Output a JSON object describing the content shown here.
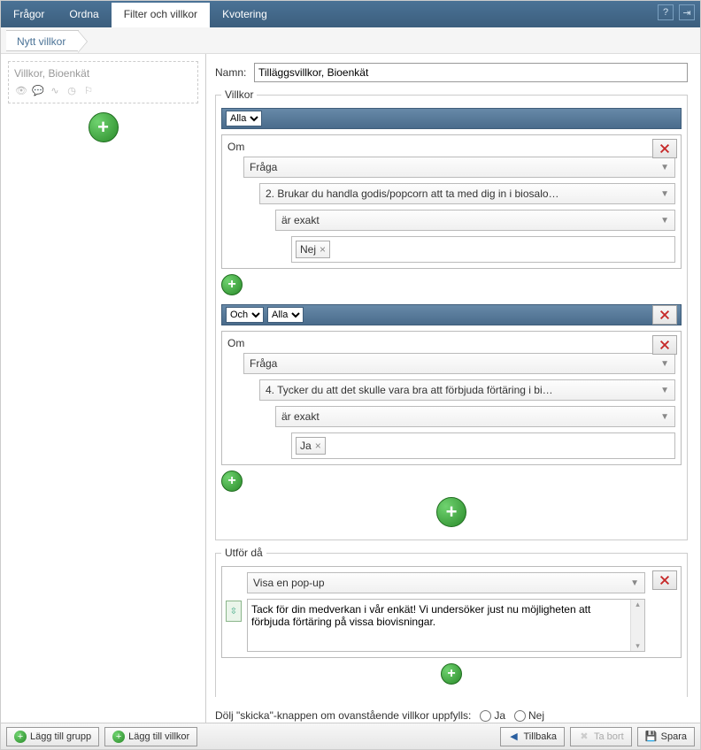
{
  "tabs": {
    "fragor": "Frågor",
    "ordna": "Ordna",
    "filter": "Filter och villkor",
    "kvotering": "Kvotering"
  },
  "breadcrumb": {
    "nytt_villkor": "Nytt villkor"
  },
  "sidebar": {
    "card_title": "Villkor, Bioenkät"
  },
  "form": {
    "name_label": "Namn:",
    "name_value": "Tilläggsvillkor, Bioenkät",
    "villkor_legend": "Villkor",
    "alla": "Alla",
    "och": "Och",
    "om": "Om",
    "fraga": "Fråga",
    "ar_exakt": "är exakt",
    "cond1_question": "2. Brukar du handla godis/popcorn att ta med dig in i biosalo…",
    "cond1_value": "Nej",
    "cond2_question": "4. Tycker du att det skulle vara bra att förbjuda förtäring i bi…",
    "cond2_value": "Ja",
    "utfor_legend": "Utför då",
    "action_type": "Visa en pop-up",
    "action_text": "Tack för din medverkan i vår enkät! Vi undersöker just nu möjligheten att förbjuda förtäring på vissa biovisningar.",
    "hide_label": "Dölj \"skicka\"-knappen om ovanstående villkor uppfylls:",
    "ja": "Ja",
    "nej": "Nej"
  },
  "footer": {
    "lagg_till_grupp": "Lägg till grupp",
    "lagg_till_villkor": "Lägg till villkor",
    "tillbaka": "Tillbaka",
    "ta_bort": "Ta bort",
    "spara": "Spara"
  }
}
